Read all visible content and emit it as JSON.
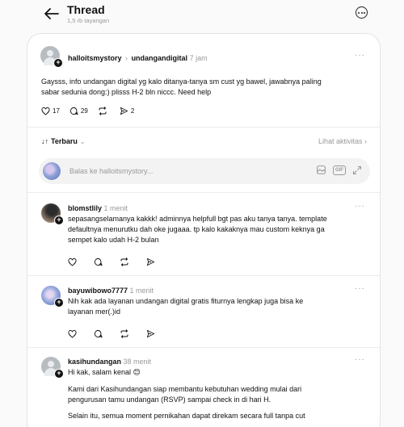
{
  "header": {
    "title": "Thread",
    "subtitle": "1,5 rb tayangan"
  },
  "post": {
    "username": "halloitsmystory",
    "reply_to": "undangandigital",
    "time": "7 jam",
    "text_line1": "Gaysss, info undangan digital yg kalo ditanya-tanya sm cust yg bawel, jawabnya paling",
    "text_line2": "sabar sedunia dong:) plisss H-2 bln niccc. Need help",
    "likes": "17",
    "comments": "29",
    "shares": "2"
  },
  "sort": {
    "label": "Terbaru",
    "activity_link": "Lihat aktivitas"
  },
  "reply_box": {
    "placeholder": "Balas ke halloitsmystory...",
    "gif_label": "GIF"
  },
  "replies": [
    {
      "username": "blomstlily",
      "time": "1 menit",
      "lines": [
        "sepasangselamanya kakkk! adminnya helpfull bgt pas aku tanya tanya. template",
        "defaultnya menurutku dah oke jugaaa. tp kalo kakaknya mau custom keknya ga",
        "sempet kalo udah H-2 bulan"
      ]
    },
    {
      "username": "bayuwibowo7777",
      "time": "1 menit",
      "lines": [
        "Nih kak ada layanan undangan digital gratis fiturnya lengkap juga bisa ke",
        "layanan mer(.)id"
      ]
    },
    {
      "username": "kasihundangan",
      "time": "38 menit",
      "lines": [
        "Hi kak, salam kenal 😊",
        "Kami dari Kasihundangan siap membantu kebutuhan wedding mulai dari",
        "pengurusan tamu undangan (RSVP) sampai check in di hari H.",
        "Selain itu, semua moment pernikahan dapat direkam secara full tanpa cut"
      ]
    }
  ],
  "colors": {
    "background": "#fafafa",
    "card": "#ffffff",
    "muted_text": "#999999"
  }
}
